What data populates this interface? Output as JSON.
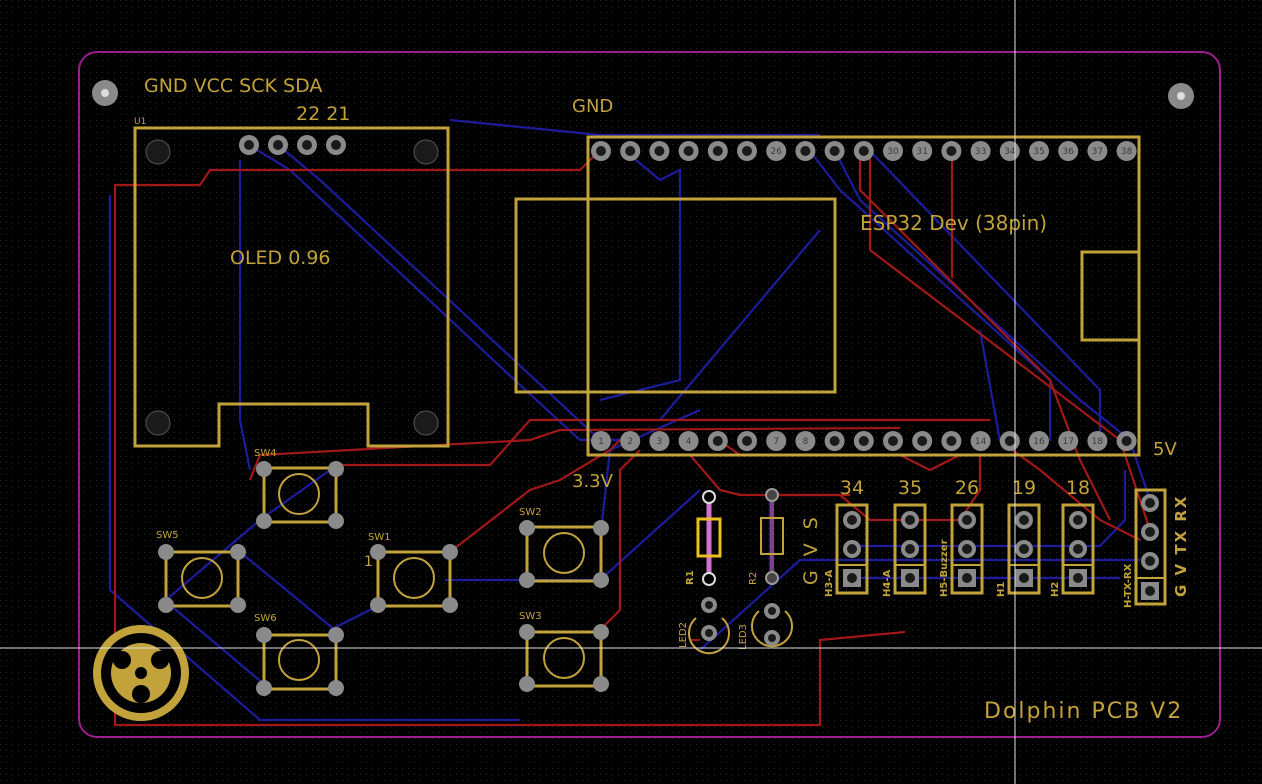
{
  "board": {
    "edge_color": "#9a1e8c",
    "silk_color": "#c2a23a",
    "front_copper_color": "#a01818",
    "back_copper_color": "#1c1c9c",
    "title": "Dolphin PCB V2"
  },
  "oled": {
    "ref": "U1",
    "pin_header": "GND VCC SCK SDA",
    "pin_gpio": "22 21",
    "value": "OLED 0.96"
  },
  "esp32": {
    "value": "ESP32 Dev (38pin)",
    "gnd_label": "GND",
    "label_5v": "5V",
    "label_33v": "3.3V",
    "top_pins": [
      "",
      "",
      "",
      "",
      "",
      "",
      "26",
      "",
      "",
      "",
      "30",
      "31",
      "",
      "33",
      "34",
      "35",
      "36",
      "37",
      "38"
    ],
    "bottom_pins": [
      "1",
      "2",
      "3",
      "4",
      "",
      "",
      "7",
      "8",
      "",
      "",
      "",
      "",
      "",
      "14",
      "",
      "16",
      "17",
      "18",
      ""
    ]
  },
  "switches": [
    "SW1",
    "SW2",
    "SW3",
    "SW4",
    "SW5",
    "SW6"
  ],
  "sw1_pad_mark": "1",
  "resistors": [
    "R1",
    "R2"
  ],
  "leds": [
    "LED2",
    "LED3"
  ],
  "servo_pins_label": "G V S",
  "uart_pins_label": "G V TX RX",
  "headers": [
    {
      "gpio": "34",
      "ref": "H3-A"
    },
    {
      "gpio": "35",
      "ref": "H4-A"
    },
    {
      "gpio": "26",
      "ref": "H5-Buzzer"
    },
    {
      "gpio": "19",
      "ref": "H1"
    },
    {
      "gpio": "18",
      "ref": "H2"
    }
  ],
  "uart_header_ref": "H-TX-RX"
}
